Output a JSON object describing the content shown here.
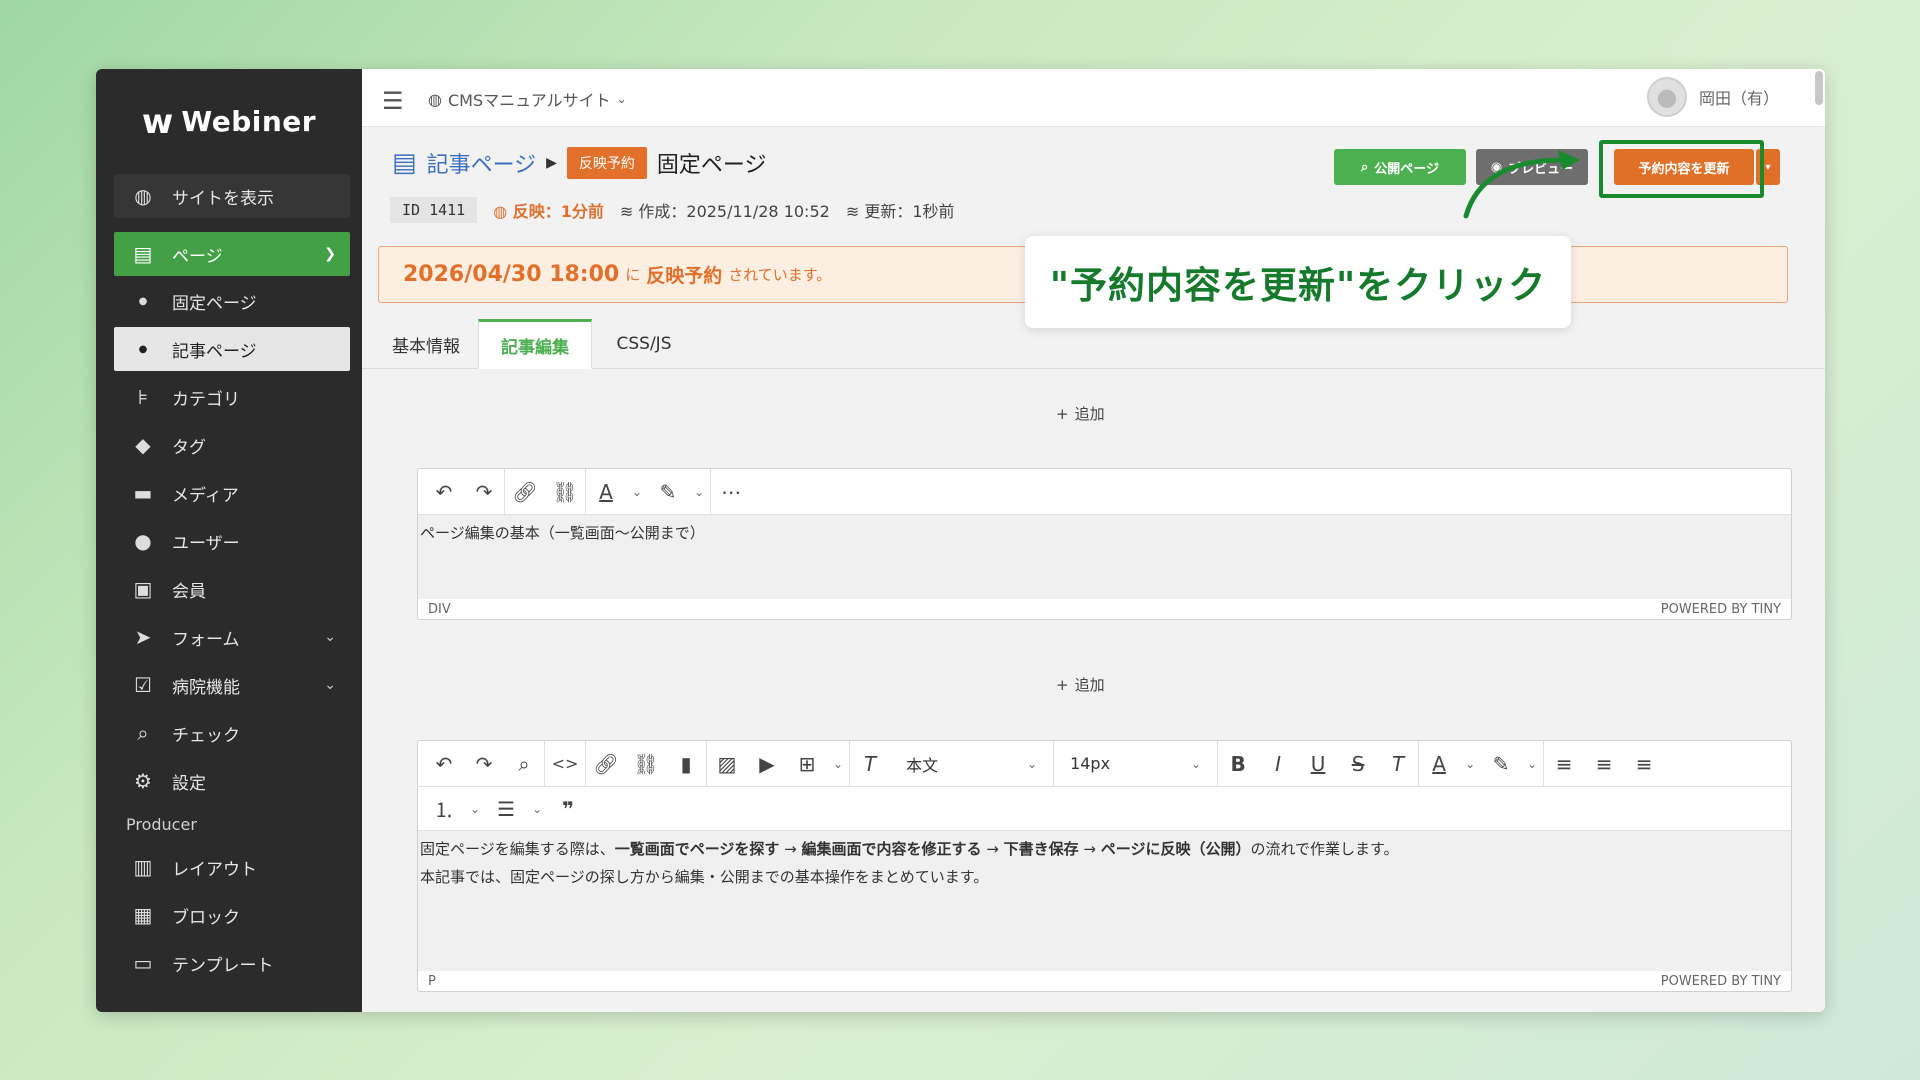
{
  "brand": {
    "mark": "w",
    "name": "Webiner"
  },
  "sidebar": {
    "view_site": "サイトを表示",
    "items": [
      {
        "label": "ページ",
        "icon": "page-icon"
      },
      {
        "label": "固定ページ",
        "icon": "bullet-icon"
      },
      {
        "label": "記事ページ",
        "icon": "bullet-icon"
      },
      {
        "label": "カテゴリ",
        "icon": "category-icon"
      },
      {
        "label": "タグ",
        "icon": "tag-icon"
      },
      {
        "label": "メディア",
        "icon": "folder-icon"
      },
      {
        "label": "ユーザー",
        "icon": "user-icon"
      },
      {
        "label": "会員",
        "icon": "member-card-icon"
      },
      {
        "label": "フォーム",
        "icon": "send-icon"
      },
      {
        "label": "病院機能",
        "icon": "clipboard-check-icon"
      },
      {
        "label": "チェック",
        "icon": "search-icon"
      },
      {
        "label": "設定",
        "icon": "gear-icon"
      }
    ],
    "section_producer": "Producer",
    "producer_items": [
      {
        "label": "レイアウト",
        "icon": "layout-icon"
      },
      {
        "label": "ブロック",
        "icon": "blocks-icon"
      },
      {
        "label": "テンプレート",
        "icon": "template-icon"
      }
    ]
  },
  "topbar": {
    "site_name": "CMSマニュアルサイト",
    "user_name": "岡田（有）"
  },
  "header": {
    "breadcrumb_parent": "記事ページ",
    "status_badge": "反映予約",
    "page_title": "固定ページ",
    "id_label": "ID 1411",
    "reflect": "反映：1分前",
    "created": "作成：2025/11/28 10:52",
    "updated": "更新：1秒前",
    "btn_public": "公開ページ",
    "btn_preview": "プレビュー",
    "btn_update": "予約内容を更新"
  },
  "notice": {
    "datetime": "2026/04/30 18:00",
    "ni": "に",
    "reserve": "反映予約",
    "suffix": "されています。"
  },
  "tabs": [
    "基本情報",
    "記事編集",
    "CSS/JS"
  ],
  "add_label": "追加",
  "editor1": {
    "content": "ページ編集の基本（一覧画面〜公開まで）",
    "path": "DIV",
    "powered": "POWERED BY TINY"
  },
  "editor2": {
    "block_format": "本文",
    "font_size": "14px",
    "line1": {
      "p1": "固定ページを編集する際は、",
      "b1": "一覧画面でページを探す",
      "arrow1": " → ",
      "b2": "編集画面で内容を修正する",
      "arrow2": " → ",
      "b3": "下書き保存",
      "arrow3": " → ",
      "b4": "ページに反映（公開）",
      "p2": "の流れで作業します。"
    },
    "line2": "本記事では、固定ページの探し方から編集・公開までの基本操作をまとめています。",
    "path": "P",
    "powered": "POWERED BY TINY"
  },
  "callout": "\"予約内容を更新\"をクリック",
  "colors": {
    "accent_green": "#4caf50",
    "accent_orange": "#e07028",
    "callout_green": "#157a2b"
  }
}
